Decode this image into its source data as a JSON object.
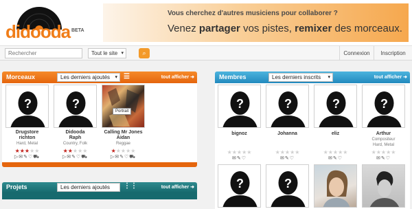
{
  "brand": {
    "name": "didooda",
    "badge": "BETA"
  },
  "banner": {
    "line1": "Vous cherchez d'autres musiciens pour collaborer ?",
    "line2_a": "Venez ",
    "line2_b": "partager",
    "line2_c": " vos pistes, ",
    "line2_d": "remixer",
    "line2_e": " des morceaux."
  },
  "search": {
    "placeholder": "Rechercher",
    "scope": "Tout le site",
    "go_icon": "search-icon"
  },
  "nav": {
    "login": "Connexion",
    "signup": "Inscription"
  },
  "colors": {
    "orange": "#e5650d",
    "blue": "#2289bd",
    "teal": "#176a6e",
    "star": "#c2231c"
  },
  "morceaux": {
    "title": "Morceaux",
    "filter": "Les derniers ajoutés",
    "see_all": "tout afficher",
    "tooltip": "Portrait",
    "items": [
      {
        "name1": "Drugstore",
        "name2": "richton",
        "genre": "Hard, Metal",
        "rating": 3
      },
      {
        "name1": "Didooda",
        "name2": "Raph",
        "genre": "Country, Folk",
        "rating": 2
      },
      {
        "name1": "Calling Mr Jones",
        "name2": "Aidan",
        "genre": "Reggae",
        "rating": 1
      }
    ]
  },
  "projets": {
    "title": "Projets",
    "filter": "Les derniers ajoutés",
    "see_all": "tout afficher"
  },
  "membres": {
    "title": "Membres",
    "filter": "Les derniers inscrits",
    "see_all": "tout afficher",
    "items": [
      {
        "name": "bignoz",
        "role": "",
        "genre": ""
      },
      {
        "name": "Johanna",
        "role": "",
        "genre": ""
      },
      {
        "name": "eliz",
        "role": "",
        "genre": ""
      },
      {
        "name": "Arthur",
        "role": "Compositeur",
        "genre": "Hard, Metal"
      }
    ]
  }
}
